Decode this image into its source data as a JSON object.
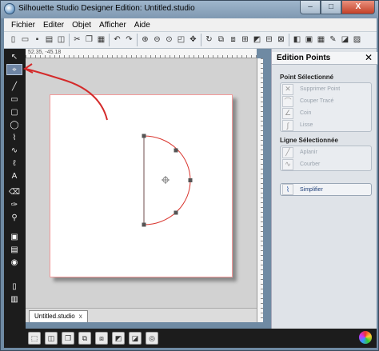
{
  "window": {
    "title": "Silhouette Studio Designer Edition: Untitled.studio",
    "minimize": "–",
    "maximize": "□",
    "close": "X"
  },
  "menu": [
    "Fichier",
    "Editer",
    "Objet",
    "Afficher",
    "Aide"
  ],
  "toolbar": {
    "icons": [
      "new",
      "open",
      "save",
      "print",
      "send-to-cutter",
      "cut",
      "copy",
      "paste",
      "undo",
      "redo",
      "zoom-in",
      "zoom-out",
      "zoom-area",
      "zoom-fit",
      "pan",
      "rotate",
      "group",
      "ungroup",
      "align",
      "duplicate",
      "replicate",
      "delete",
      "weld",
      "offset",
      "grid",
      "pen",
      "fill",
      "stroke"
    ]
  },
  "ruler": {
    "coordinate": "52.35, -45.18"
  },
  "document": {
    "tab_label": "Untitled.studio",
    "tab_close": "x",
    "page_border_color": "#f29a9a",
    "shape_color": "#d9362f"
  },
  "left_tools": [
    "select",
    "edit-points",
    "line",
    "rectangle",
    "rounded-rectangle",
    "ellipse",
    "polygon",
    "curve",
    "freehand",
    "smooth-freehand",
    "text",
    "eraser",
    "knife",
    "eyedropper",
    "fill-bucket",
    "cut-settings",
    "page-setup",
    "library",
    "store",
    "register",
    "layout"
  ],
  "panel": {
    "title": "Edition Points",
    "close": "✕",
    "section_point": "Point Sélectionné",
    "point_items": [
      "Supprimer Point",
      "Couper Tracé",
      "Coin",
      "Lisse"
    ],
    "section_line": "Ligne Sélectionnée",
    "line_items": [
      "Aplanir",
      "Courber"
    ],
    "simplify": "Simplifier"
  },
  "annotation_color": "#d42a2a"
}
